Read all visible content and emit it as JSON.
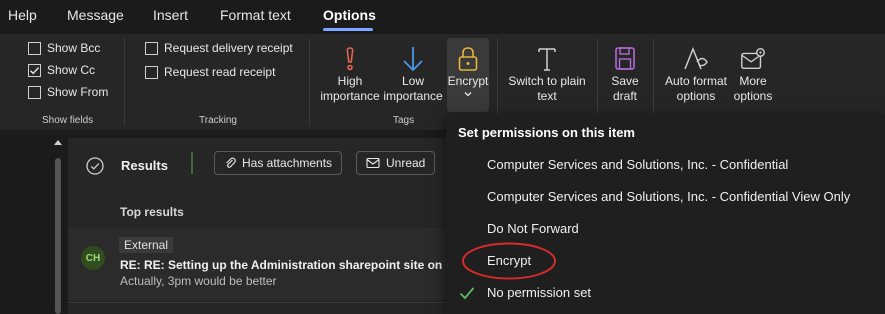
{
  "tabs": [
    {
      "label": "Help"
    },
    {
      "label": "Message"
    },
    {
      "label": "Insert"
    },
    {
      "label": "Format text"
    },
    {
      "label": "Options",
      "active": true
    }
  ],
  "ribbon": {
    "show_fields": {
      "label": "Show fields",
      "items": [
        {
          "label": "Show Bcc",
          "checked": false
        },
        {
          "label": "Show Cc",
          "checked": true
        },
        {
          "label": "Show From",
          "checked": false
        }
      ]
    },
    "tracking": {
      "label": "Tracking",
      "items": [
        {
          "label": "Request delivery receipt",
          "checked": false
        },
        {
          "label": "Request read receipt",
          "checked": false
        }
      ]
    },
    "tags": {
      "label": "Tags",
      "high": [
        "High",
        "importance"
      ],
      "low": [
        "Low",
        "importance"
      ],
      "encrypt": "Encrypt"
    },
    "switch_plain": [
      "Switch to plain",
      "text"
    ],
    "save_draft": [
      "Save",
      "draft"
    ],
    "auto_format": [
      "Auto format",
      "options"
    ],
    "more_options": [
      "More",
      "options"
    ]
  },
  "mail_list": {
    "results_label": "Results",
    "filters": [
      {
        "label": "Has attachments",
        "icon": "paperclip-icon"
      },
      {
        "label": "Unread",
        "icon": "envelope-icon"
      }
    ],
    "section_header": "Top results",
    "items": [
      {
        "avatar": "CH",
        "tag": "External",
        "subject": "RE: RE: Setting up the Administration sharepoint site on your c",
        "preview": "Actually, 3pm would be better"
      }
    ]
  },
  "encrypt_menu": {
    "header": "Set permissions on this item",
    "items": [
      {
        "label": "Computer Services and Solutions, Inc. - Confidential",
        "selected": false
      },
      {
        "label": "Computer Services and Solutions, Inc. - Confidential View Only",
        "selected": false
      },
      {
        "label": "Do Not Forward",
        "selected": false
      },
      {
        "label": "Encrypt",
        "selected": false,
        "highlighted": true
      },
      {
        "label": "No permission set",
        "selected": true
      }
    ]
  },
  "colors": {
    "accent": "#7aa7ff",
    "high_importance": "#e0654f",
    "low_importance": "#4a9ae8",
    "encrypt_lock": "#e8b53a",
    "save_icon": "#b46ad6",
    "checkmark": "#5dbb63",
    "annotation_circle": "#d42b2b",
    "avatar_bg": "#2f4d1e",
    "avatar_fg": "#9fd87a"
  }
}
